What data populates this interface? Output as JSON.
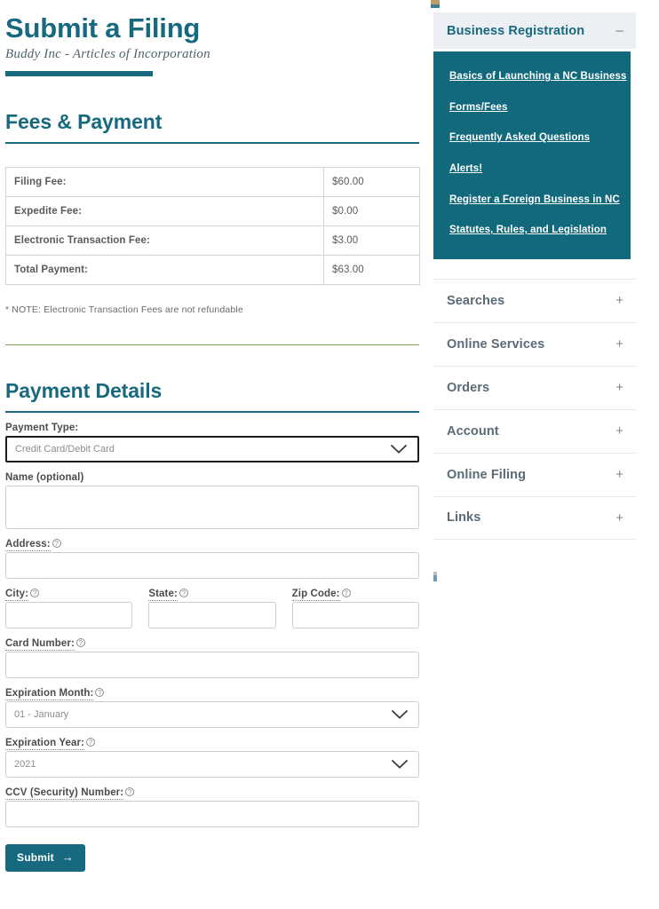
{
  "header": {
    "title": "Submit a Filing",
    "subtitle": "Buddy Inc - Articles of Incorporation"
  },
  "fees_section": {
    "heading": "Fees & Payment",
    "rows": [
      {
        "label": "Filing Fee:",
        "amount": "$60.00"
      },
      {
        "label": "Expedite Fee:",
        "amount": "$0.00"
      },
      {
        "label": "Electronic Transaction Fee:",
        "amount": "$3.00"
      },
      {
        "label": "Total Payment:",
        "amount": "$63.00"
      }
    ],
    "note": "* NOTE: Electronic Transaction Fees are not refundable"
  },
  "payment_section": {
    "heading": "Payment Details",
    "fields": {
      "payment_type": {
        "label": "Payment Type:",
        "value": "Credit Card/Debit Card",
        "options": [
          "Credit Card/Debit Card"
        ]
      },
      "name": {
        "label": "Name (optional)",
        "value": ""
      },
      "address": {
        "label": "Address:",
        "value": ""
      },
      "city": {
        "label": "City:",
        "value": ""
      },
      "state": {
        "label": "State:",
        "value": ""
      },
      "zip": {
        "label": "Zip Code:",
        "value": ""
      },
      "card_number": {
        "label": "Card Number:",
        "value": ""
      },
      "expiration_month": {
        "label": "Expiration Month:",
        "value": "01 - January",
        "options": [
          "01 - January"
        ]
      },
      "expiration_year": {
        "label": "Expiration Year:",
        "value": "2021",
        "options": [
          "2021"
        ]
      },
      "ccv": {
        "label": "CCV (Security) Number:",
        "value": ""
      }
    },
    "submit_label": "Submit",
    "submit_arrow": "→"
  },
  "sidebar": {
    "open_section": {
      "title": "Business Registration",
      "toggle": "–",
      "links": [
        "Basics of Launching a NC Business",
        "Forms/Fees",
        "Frequently Asked Questions",
        "Alerts!",
        "Register a Foreign Business in NC",
        "Statutes, Rules, and Legislation"
      ]
    },
    "collapsed_sections": [
      {
        "title": "Searches",
        "toggle": "+"
      },
      {
        "title": "Online Services",
        "toggle": "+"
      },
      {
        "title": "Orders",
        "toggle": "+"
      },
      {
        "title": "Account",
        "toggle": "+"
      },
      {
        "title": "Online Filing",
        "toggle": "+"
      },
      {
        "title": "Links",
        "toggle": "+"
      }
    ]
  },
  "icons": {
    "help": "?",
    "chevron_down": "chevron-down-icon"
  },
  "colors": {
    "brand_teal": "#16697f",
    "panel_teal": "#12697c",
    "olive_rule": "#7fa454",
    "header_bg": "#eceff3"
  }
}
